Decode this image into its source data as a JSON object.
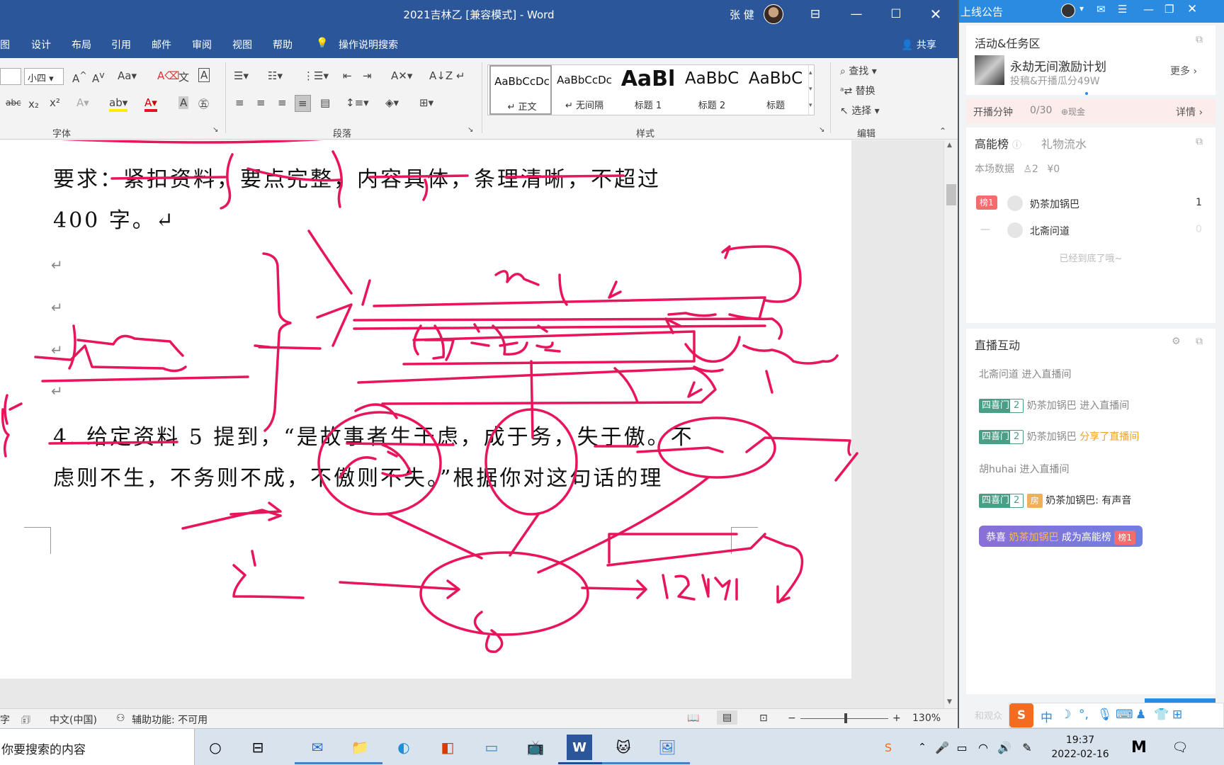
{
  "window": {
    "title": "2021吉林乙 [兼容模式]  -  Word",
    "user_name": "张 健",
    "min_glyph": "—",
    "max_glyph": "☐",
    "close_glyph": "✕",
    "ribbon_display_glyph": "⊟"
  },
  "menu": {
    "items": [
      "图",
      "设计",
      "布局",
      "引用",
      "邮件",
      "审阅",
      "视图",
      "帮助"
    ],
    "tell_me": "操作说明搜索",
    "share": "共享"
  },
  "ribbon": {
    "font_size_value": "小四",
    "font_group_label": "字体",
    "paragraph_group_label": "段落",
    "styles_group_label": "样式",
    "editing_group_label": "编辑",
    "find_label": "查找",
    "replace_label": "替换",
    "select_label": "选择",
    "styles": [
      {
        "sample": "AaBbCcDc",
        "name": "↵ 正文"
      },
      {
        "sample": "AaBbCcDc",
        "name": "↵ 无间隔"
      },
      {
        "sample": "AaBl",
        "name": "标题 1"
      },
      {
        "sample": "AaBbC",
        "name": "标题 2"
      },
      {
        "sample": "AaBbC",
        "name": "标题"
      }
    ]
  },
  "document": {
    "line1": "要求：紧扣资料，要点完整，内容具体，条理清晰，不超过",
    "line2": "400 字。↵",
    "para_mark": "↵",
    "question_line1": "4. 给定资料 5 提到，“是故事者生于虑，成于务，失于傲。不",
    "question_line2": "虑则不生，不务则不成，不傲则不失。”根据你对这句话的理"
  },
  "status": {
    "language": "中文(中国)",
    "accessibility": "辅助功能: 不可用",
    "zoom": "130%",
    "left_fragment": "字"
  },
  "panel": {
    "header": "上线公告",
    "activity_title": "活动&任务区",
    "plan_title": "永劫无间激励计划",
    "plan_sub": "投稿&开播瓜分49W",
    "more": "更多",
    "live_minutes_label": "开播分钟",
    "live_minutes_value": "0/30",
    "cash_label": "⊕现金",
    "details": "详情",
    "tab_energy": "高能榜",
    "tab_gifts": "礼物流水",
    "session_data": "本场数据",
    "viewers": "2",
    "revenue": "¥0",
    "rank_badge": "榜1",
    "rank_dash": "—",
    "rank": [
      {
        "name": "奶茶加锅巴",
        "score": "1"
      },
      {
        "name": "北斋问道",
        "score": "0"
      }
    ],
    "bottom_note": "已经到底了哦~",
    "interaction_title": "直播互动",
    "fan_badge": "四喜门",
    "fan_level": "2",
    "room_badge": "房",
    "msg_enter_1_user": "北斋问道",
    "msg_enter_label": "进入直播间",
    "msg_user": "奶茶加锅巴",
    "msg_share": "分享了直播间",
    "msg_enter_2_user": "胡huhai",
    "msg_chat": "奶茶加锅巴: 有声音",
    "congrats_prefix": "恭喜",
    "congrats_user": "奶茶加锅巴",
    "congrats_suffix": "成为高能榜",
    "input_placeholder": "和观众"
  },
  "taskbar": {
    "search_text": "你要搜索的内容",
    "time": "19:37",
    "date": "2022-02-16",
    "ime_label": "中"
  },
  "colors": {
    "word_blue": "#2b579a",
    "ink": "#e8155a",
    "panel_blue": "#2a8be0",
    "fan_green": "#4a9e86"
  }
}
